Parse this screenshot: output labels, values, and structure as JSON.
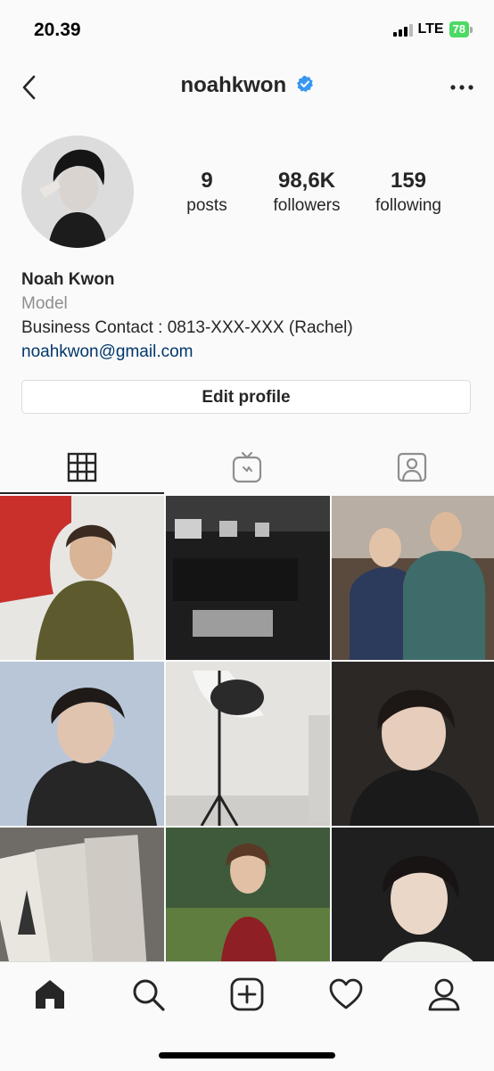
{
  "status": {
    "time": "20.39",
    "network": "LTE",
    "battery": "78"
  },
  "header": {
    "username": "noahkwon",
    "back_icon": "chevron-left-icon",
    "verified_icon": "verified-badge-icon",
    "more_icon": "more-horizontal-icon"
  },
  "stats": [
    {
      "value": "9",
      "label": "posts"
    },
    {
      "value": "98,6K",
      "label": "followers"
    },
    {
      "value": "159",
      "label": "following"
    }
  ],
  "bio": {
    "name": "Noah Kwon",
    "category": "Model",
    "line": "Business Contact : 0813-XXX-XXX (Rachel)",
    "link": "noahkwon@gmail.com"
  },
  "edit_profile_label": "Edit profile",
  "tabs": [
    {
      "icon": "grid-icon",
      "active": true
    },
    {
      "icon": "igtv-icon",
      "active": false
    },
    {
      "icon": "tagged-icon",
      "active": false
    }
  ],
  "posts": [
    {
      "desc": "photo-1",
      "bg": "#7a6a52"
    },
    {
      "desc": "photo-2",
      "bg": "#2b2b2b"
    },
    {
      "desc": "photo-3",
      "bg": "#6b6560"
    },
    {
      "desc": "photo-4",
      "bg": "#9fb0c8"
    },
    {
      "desc": "photo-5",
      "bg": "#d8d8d6"
    },
    {
      "desc": "photo-6",
      "bg": "#3a3633"
    },
    {
      "desc": "photo-7",
      "bg": "#8a8680"
    },
    {
      "desc": "photo-8",
      "bg": "#4f6a45"
    },
    {
      "desc": "photo-9",
      "bg": "#2a2a2a"
    }
  ],
  "bottom_nav": [
    {
      "icon": "home-icon"
    },
    {
      "icon": "search-icon"
    },
    {
      "icon": "new-post-icon"
    },
    {
      "icon": "activity-heart-icon"
    },
    {
      "icon": "profile-icon"
    }
  ],
  "colors": {
    "link": "#00376b",
    "verified": "#3897f0",
    "battery": "#4cd964"
  }
}
